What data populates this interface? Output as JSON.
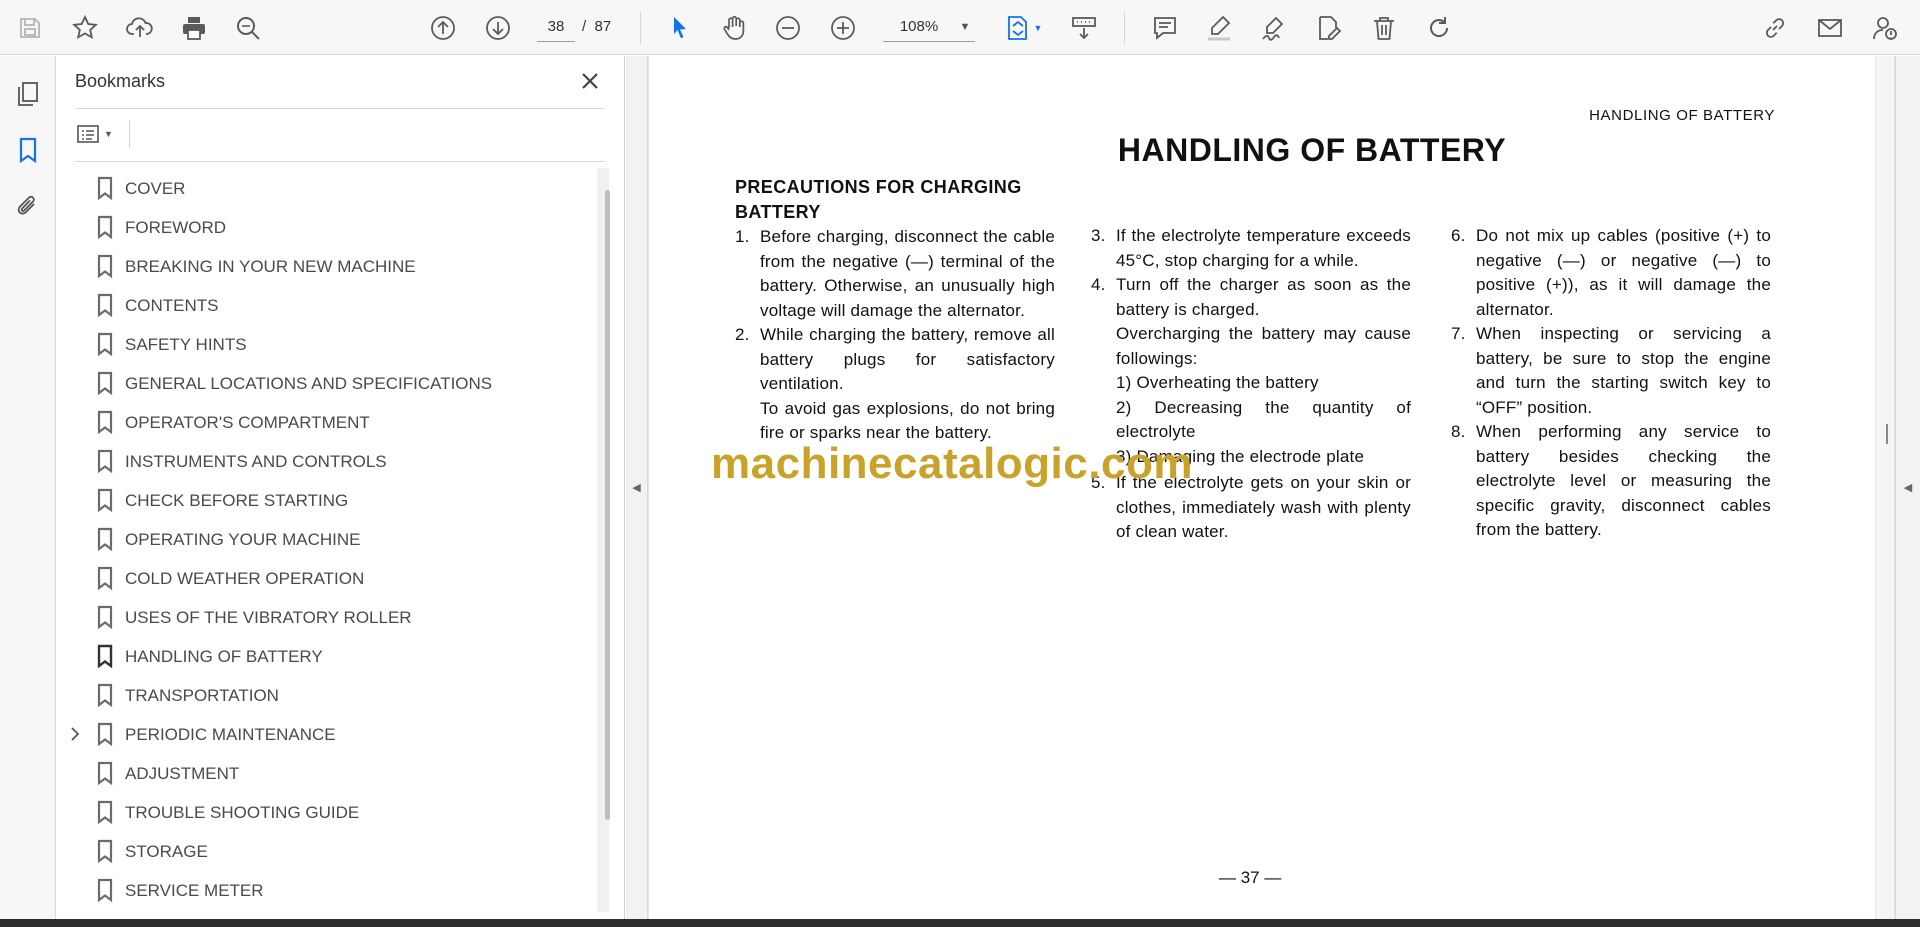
{
  "toolbar": {
    "current_page": "38",
    "page_separator": "/",
    "total_pages": "87",
    "zoom": "108%",
    "icons": [
      "save-icon",
      "star-icon",
      "upload-icon",
      "print-icon",
      "zoom-search-icon",
      "prev-page-icon",
      "next-page-icon",
      "select-cursor-icon",
      "hand-icon",
      "zoom-out-icon",
      "zoom-in-icon",
      "fit-page-icon",
      "scroll-mode-icon",
      "comment-icon",
      "highlight-icon",
      "sign-icon",
      "edit-icon",
      "delete-icon",
      "rotate-icon",
      "link-icon",
      "email-icon",
      "account-icon"
    ]
  },
  "bookmarks": {
    "title": "Bookmarks",
    "items": [
      {
        "label": "COVER"
      },
      {
        "label": "FOREWORD"
      },
      {
        "label": "BREAKING IN YOUR NEW MACHINE"
      },
      {
        "label": "CONTENTS"
      },
      {
        "label": "SAFETY HINTS"
      },
      {
        "label": "GENERAL LOCATIONS AND SPECIFICATIONS"
      },
      {
        "label": "OPERATOR'S COMPARTMENT"
      },
      {
        "label": "INSTRUMENTS AND CONTROLS"
      },
      {
        "label": "CHECK BEFORE STARTING"
      },
      {
        "label": "OPERATING YOUR MACHINE"
      },
      {
        "label": "COLD WEATHER OPERATION"
      },
      {
        "label": "USES OF THE VIBRATORY ROLLER"
      },
      {
        "label": "HANDLING OF BATTERY"
      },
      {
        "label": "TRANSPORTATION"
      },
      {
        "label": "PERIODIC MAINTENANCE"
      },
      {
        "label": "ADJUSTMENT"
      },
      {
        "label": "TROUBLE SHOOTING GUIDE"
      },
      {
        "label": "STORAGE"
      },
      {
        "label": "SERVICE METER"
      }
    ]
  },
  "page": {
    "header": "HANDLING OF BATTERY",
    "title": "HANDLING OF BATTERY",
    "subhead": "PRECAUTIONS FOR CHARGING BATTERY",
    "col1": {
      "i1_num": "1.",
      "i1": "Before charging, disconnect the cable from the negative (—) terminal of the battery. Otherwise, an unusually high voltage will damage the alternator.",
      "i2_num": "2.",
      "i2": "While charging the battery, remove all battery plugs for satisfactory ventilation.",
      "i2_p": "To avoid gas explosions, do not bring fire or sparks near the battery."
    },
    "col2": {
      "i3_num": "3.",
      "i3": "If the electrolyte temperature exceeds 45°C, stop charging for a while.",
      "i4_num": "4.",
      "i4": "Turn off the charger as soon as the battery is charged.",
      "i4_p": "Overcharging the battery may cause followings:",
      "s1": "1) Overheating the battery",
      "s2": "2) Decreasing the quantity of electrolyte",
      "s3": "3) Damaging the electrode plate",
      "i5_num": "5.",
      "i5": "If the electrolyte gets on your skin or clothes, immediately wash with plenty of clean water."
    },
    "col3": {
      "i6_num": "6.",
      "i6": "Do not mix up cables (positive (+) to negative (—) or negative (—) to positive (+)), as it will damage the alternator.",
      "i7_num": "7.",
      "i7": "When inspecting or servicing a battery, be sure to stop the engine and turn the starting switch key to “OFF” position.",
      "i8_num": "8.",
      "i8": "When performing any service to battery besides checking the electrolyte level or measuring the specific gravity, disconnect cables from the battery."
    },
    "footer": "— 37 —",
    "watermark": "machinecatalogic.com"
  },
  "colors": {
    "accent": "#1473e6",
    "watermark": "#c9a22a"
  }
}
